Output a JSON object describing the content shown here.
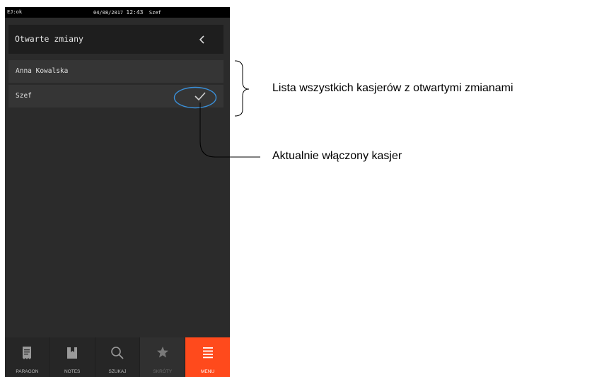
{
  "status_bar": {
    "left": "EJ:ok",
    "date": "04/08/2017",
    "time": "12:43",
    "user": "Szef"
  },
  "header": {
    "title": "Otwarte zmiany",
    "back_icon": "chevron-left-icon"
  },
  "cashiers": [
    {
      "name": "Anna Kowalska",
      "active": false
    },
    {
      "name": "Szef",
      "active": true
    }
  ],
  "nav": [
    {
      "label": "PARAGON",
      "icon": "receipt-icon",
      "state": "normal"
    },
    {
      "label": "NOTES",
      "icon": "bookmark-icon",
      "state": "normal"
    },
    {
      "label": "SZUKAJ",
      "icon": "search-icon",
      "state": "normal"
    },
    {
      "label": "SKRÓTY",
      "icon": "star-icon",
      "state": "disabled"
    },
    {
      "label": "MENU",
      "icon": "menu-icon",
      "state": "active"
    }
  ],
  "annotations": {
    "list_caption": "Lista wszystkich kasjerów z otwartymi zmianami",
    "active_caption": "Aktualnie włączony kasjer"
  },
  "colors": {
    "accent": "#ff4a1c",
    "highlight": "#3a8fd8",
    "background": "#2b2b2b"
  }
}
